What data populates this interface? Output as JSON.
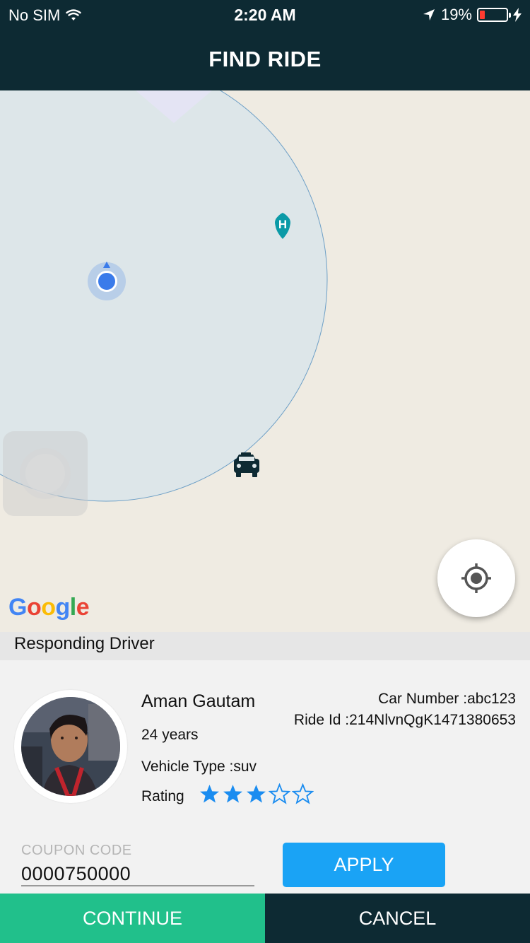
{
  "status_bar": {
    "carrier": "No SIM",
    "time": "2:20 AM",
    "battery_percent": "19%",
    "battery_level": 0.19,
    "icons": [
      "wifi-icon",
      "location-arrow-icon",
      "battery-icon",
      "charging-bolt-icon"
    ]
  },
  "nav": {
    "title": "FIND RIDE"
  },
  "map": {
    "provider_logo": "Google",
    "markers": [
      "user-location-dot",
      "hotel-pin-icon",
      "taxi-icon"
    ],
    "locate_button_icon": "crosshair-icon"
  },
  "section": {
    "title": "Responding Driver"
  },
  "driver": {
    "name": "Aman Gautam",
    "age": "24 years",
    "vehicle_type": "Vehicle Type :suv",
    "rating_label": "Rating",
    "rating": 3,
    "rating_max": 5,
    "car_number": "Car Number :abc123",
    "ride_id": "Ride Id :214NlvnQgK1471380653"
  },
  "coupon": {
    "label": "COUPON CODE",
    "value": "0000750000",
    "apply_label": "APPLY"
  },
  "actions": {
    "continue_label": "CONTINUE",
    "cancel_label": "CANCEL"
  },
  "colors": {
    "header_bg": "#0d2a33",
    "continue_bg": "#21c08b",
    "apply_bg": "#1aa3f5",
    "star_color": "#1a8cf0",
    "battery_low": "#ff3b30"
  }
}
